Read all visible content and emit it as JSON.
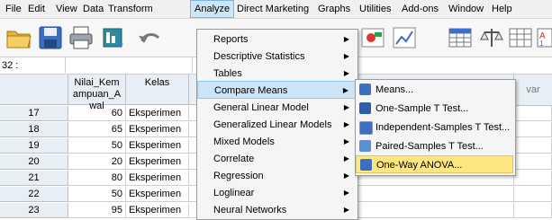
{
  "menubar": {
    "items": [
      "File",
      "Edit",
      "View",
      "Data",
      "Transform",
      "Analyze",
      "Direct Marketing",
      "Graphs",
      "Utilities",
      "Add-ons",
      "Window",
      "Help"
    ]
  },
  "cell_editor": {
    "ref": "32 :"
  },
  "grid": {
    "col1_header": "Nilai_Kemampuan_Awal",
    "col2_header": "Kelas",
    "var_header": "var",
    "rows": [
      {
        "n": "17",
        "v": "60",
        "k": "Eksperimen"
      },
      {
        "n": "18",
        "v": "65",
        "k": "Eksperimen"
      },
      {
        "n": "19",
        "v": "50",
        "k": "Eksperimen"
      },
      {
        "n": "20",
        "v": "20",
        "k": "Eksperimen"
      },
      {
        "n": "21",
        "v": "80",
        "k": "Eksperimen"
      },
      {
        "n": "22",
        "v": "50",
        "k": "Eksperimen"
      },
      {
        "n": "23",
        "v": "95",
        "k": "Eksperimen"
      }
    ]
  },
  "analyze_menu": {
    "items": [
      "Reports",
      "Descriptive Statistics",
      "Tables",
      "Compare Means",
      "General Linear Model",
      "Generalized Linear Models",
      "Mixed Models",
      "Correlate",
      "Regression",
      "Loglinear",
      "Neural Networks"
    ]
  },
  "compare_means_submenu": {
    "items": [
      "Means...",
      "One-Sample T Test...",
      "Independent-Samples T Test...",
      "Paired-Samples T Test...",
      "One-Way ANOVA..."
    ]
  },
  "colors": {
    "menu_highlight": "#cce4f7",
    "submenu_highlight": "#ffe780",
    "header_bg": "#e8eef6"
  }
}
